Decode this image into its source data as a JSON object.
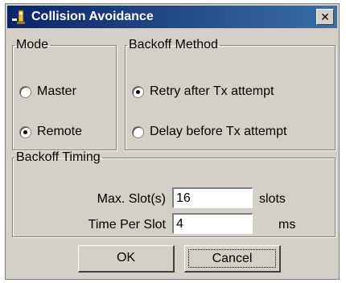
{
  "window": {
    "title": "Collision Avoidance",
    "close_glyph": "✕"
  },
  "mode": {
    "legend": "Mode",
    "options": [
      {
        "label": "Master",
        "checked": false
      },
      {
        "label": "Remote",
        "checked": true
      }
    ]
  },
  "backoff_method": {
    "legend": "Backoff Method",
    "options": [
      {
        "label": "Retry after Tx attempt",
        "checked": true
      },
      {
        "label": "Delay before Tx attempt",
        "checked": false
      }
    ]
  },
  "backoff_timing": {
    "legend": "Backoff Timing",
    "max_slots_label": "Max. Slot(s)",
    "max_slots_value": "16",
    "max_slots_unit": "slots",
    "time_per_slot_label": "Time Per Slot",
    "time_per_slot_value": "4",
    "time_per_slot_unit": "ms"
  },
  "buttons": {
    "ok": "OK",
    "cancel": "Cancel"
  },
  "colors": {
    "titlebar_start": "#0a246a",
    "titlebar_end": "#3a6ea5",
    "window_bg": "#d4d0c8"
  },
  "icons": {
    "title": "app-window-icon",
    "close": "close-icon"
  }
}
